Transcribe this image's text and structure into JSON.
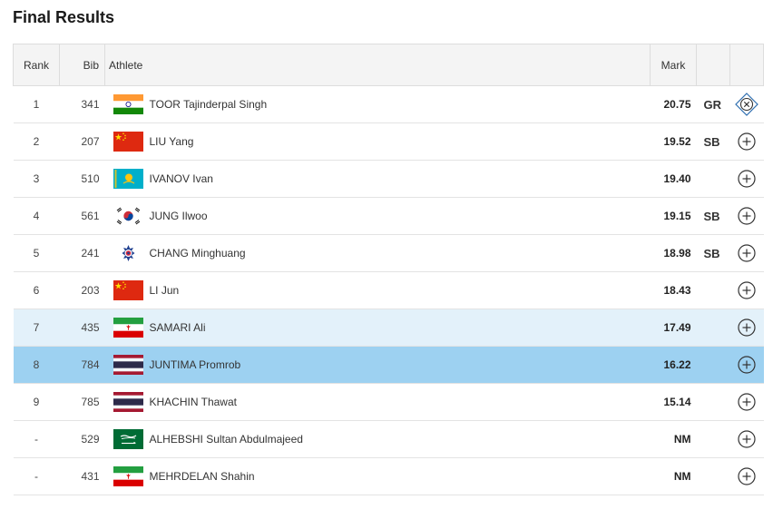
{
  "page": {
    "title": "Final Results"
  },
  "table": {
    "headers": {
      "rank": "Rank",
      "bib": "Bib",
      "athlete": "Athlete",
      "mark": "Mark"
    },
    "rows": [
      {
        "rank": "1",
        "bib": "341",
        "flag": "IND",
        "athlete": "TOOR Tajinderpal Singh",
        "mark": "20.75",
        "note": "GR",
        "expanded": true,
        "state": "normal"
      },
      {
        "rank": "2",
        "bib": "207",
        "flag": "CHN",
        "athlete": "LIU Yang",
        "mark": "19.52",
        "note": "SB",
        "expanded": false,
        "state": "normal"
      },
      {
        "rank": "3",
        "bib": "510",
        "flag": "KAZ",
        "athlete": "IVANOV Ivan",
        "mark": "19.40",
        "note": "",
        "expanded": false,
        "state": "normal"
      },
      {
        "rank": "4",
        "bib": "561",
        "flag": "KOR",
        "athlete": "JUNG Ilwoo",
        "mark": "19.15",
        "note": "SB",
        "expanded": false,
        "state": "normal"
      },
      {
        "rank": "5",
        "bib": "241",
        "flag": "TPE",
        "athlete": "CHANG Minghuang",
        "mark": "18.98",
        "note": "SB",
        "expanded": false,
        "state": "normal"
      },
      {
        "rank": "6",
        "bib": "203",
        "flag": "CHN",
        "athlete": "LI Jun",
        "mark": "18.43",
        "note": "",
        "expanded": false,
        "state": "normal"
      },
      {
        "rank": "7",
        "bib": "435",
        "flag": "IRI",
        "athlete": "SAMARI Ali",
        "mark": "17.49",
        "note": "",
        "expanded": false,
        "state": "hover"
      },
      {
        "rank": "8",
        "bib": "784",
        "flag": "THA",
        "athlete": "JUNTIMA Promrob",
        "mark": "16.22",
        "note": "",
        "expanded": false,
        "state": "selected"
      },
      {
        "rank": "9",
        "bib": "785",
        "flag": "THA",
        "athlete": "KHACHIN Thawat",
        "mark": "15.14",
        "note": "",
        "expanded": false,
        "state": "normal"
      },
      {
        "rank": "-",
        "bib": "529",
        "flag": "KSA",
        "athlete": "ALHEBSHI Sultan Abdulmajeed",
        "mark": "NM",
        "note": "",
        "expanded": false,
        "state": "normal"
      },
      {
        "rank": "-",
        "bib": "431",
        "flag": "IRI",
        "athlete": "MEHRDELAN Shahin",
        "mark": "NM",
        "note": "",
        "expanded": false,
        "state": "normal"
      }
    ]
  },
  "icons": {
    "expand": "plus-circle-icon",
    "collapse": "close-diamond-icon"
  },
  "colors": {
    "hover_row": "#e3f1fa",
    "selected_row": "#9dd1f1",
    "expanded_icon": "#2f6fb0"
  }
}
